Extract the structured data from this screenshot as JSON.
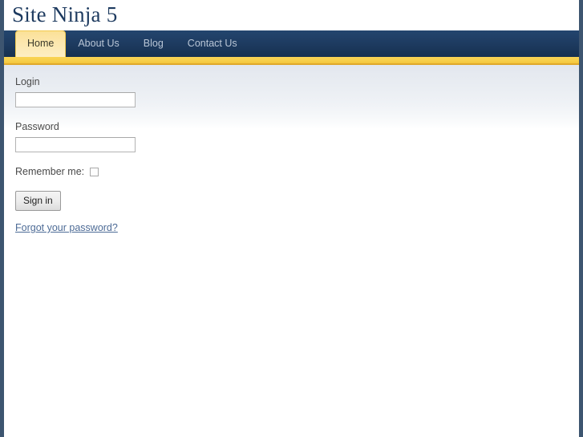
{
  "site": {
    "title": "Site Ninja 5"
  },
  "nav": {
    "items": [
      {
        "label": "Home",
        "active": true
      },
      {
        "label": "About Us",
        "active": false
      },
      {
        "label": "Blog",
        "active": false
      },
      {
        "label": "Contact Us",
        "active": false
      }
    ]
  },
  "login_form": {
    "login_label": "Login",
    "login_value": "",
    "login_placeholder": "",
    "password_label": "Password",
    "password_value": "",
    "password_placeholder": "",
    "remember_label": "Remember me:",
    "remember_checked": false,
    "submit_label": "Sign in",
    "forgot_link_label": "Forgot your password?"
  },
  "colors": {
    "navy_border": "#3d5570",
    "navbar": "#1d3a5f",
    "gold_bar": "#f7cf4a",
    "active_tab": "#fce7ae",
    "title_text": "#1d3a5f",
    "link": "#4d6b96",
    "content_top": "#e3e7ee"
  }
}
